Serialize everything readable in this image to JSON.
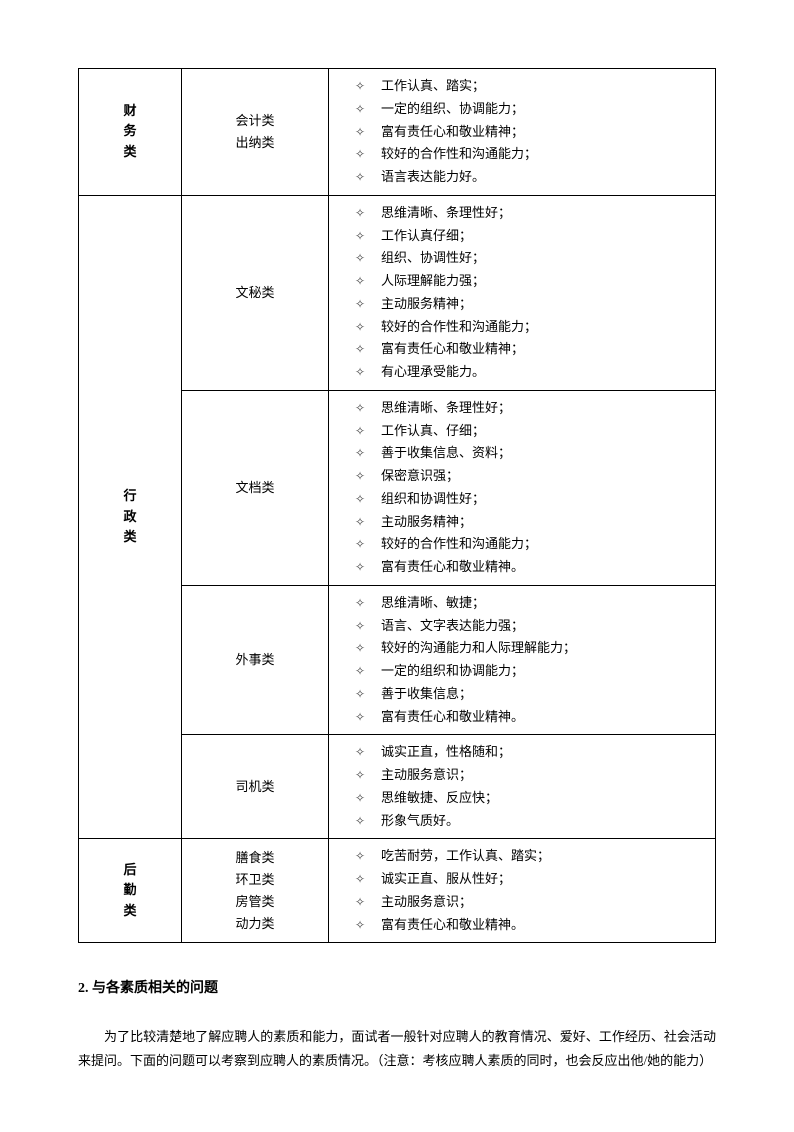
{
  "table": {
    "rows": [
      {
        "category": "财务类",
        "sub": [
          "会计类",
          "出纳类"
        ],
        "items": [
          "工作认真、踏实；",
          "一定的组织、协调能力；",
          "富有责任心和敬业精神；",
          "较好的合作性和沟通能力；",
          "语言表达能力好。"
        ]
      },
      {
        "category": "行政类",
        "groups": [
          {
            "sub": [
              "文秘类"
            ],
            "items": [
              "思维清晰、条理性好；",
              "工作认真仔细；",
              "组织、协调性好；",
              "人际理解能力强；",
              "主动服务精神；",
              "较好的合作性和沟通能力；",
              "富有责任心和敬业精神；",
              "有心理承受能力。"
            ]
          },
          {
            "sub": [
              "文档类"
            ],
            "items": [
              "思维清晰、条理性好；",
              "工作认真、仔细；",
              "善于收集信息、资料；",
              "保密意识强；",
              "组织和协调性好；",
              "主动服务精神；",
              "较好的合作性和沟通能力；",
              "富有责任心和敬业精神。"
            ]
          },
          {
            "sub": [
              "外事类"
            ],
            "items": [
              "思维清晰、敏捷；",
              "语言、文字表达能力强；",
              "较好的沟通能力和人际理解能力；",
              "一定的组织和协调能力；",
              "善于收集信息；",
              "富有责任心和敬业精神。"
            ]
          },
          {
            "sub": [
              "司机类"
            ],
            "items": [
              "诚实正直，性格随和；",
              "主动服务意识；",
              "思维敏捷、反应快；",
              "形象气质好。"
            ]
          }
        ]
      },
      {
        "category": "后勤类",
        "sub": [
          "膳食类",
          "环卫类",
          "房管类",
          "动力类"
        ],
        "items": [
          "吃苦耐劳，工作认真、踏实；",
          "诚实正直、服从性好；",
          "主动服务意识；",
          "富有责任心和敬业精神。"
        ]
      }
    ]
  },
  "section_heading": "2.  与各素质相关的问题",
  "body": "为了比较清楚地了解应聘人的素质和能力，面试者一般针对应聘人的教育情况、爱好、工作经历、社会活动来提问。下面的问题可以考察到应聘人的素质情况。（注意：考核应聘人素质的同时，也会反应出他/她的能力）"
}
